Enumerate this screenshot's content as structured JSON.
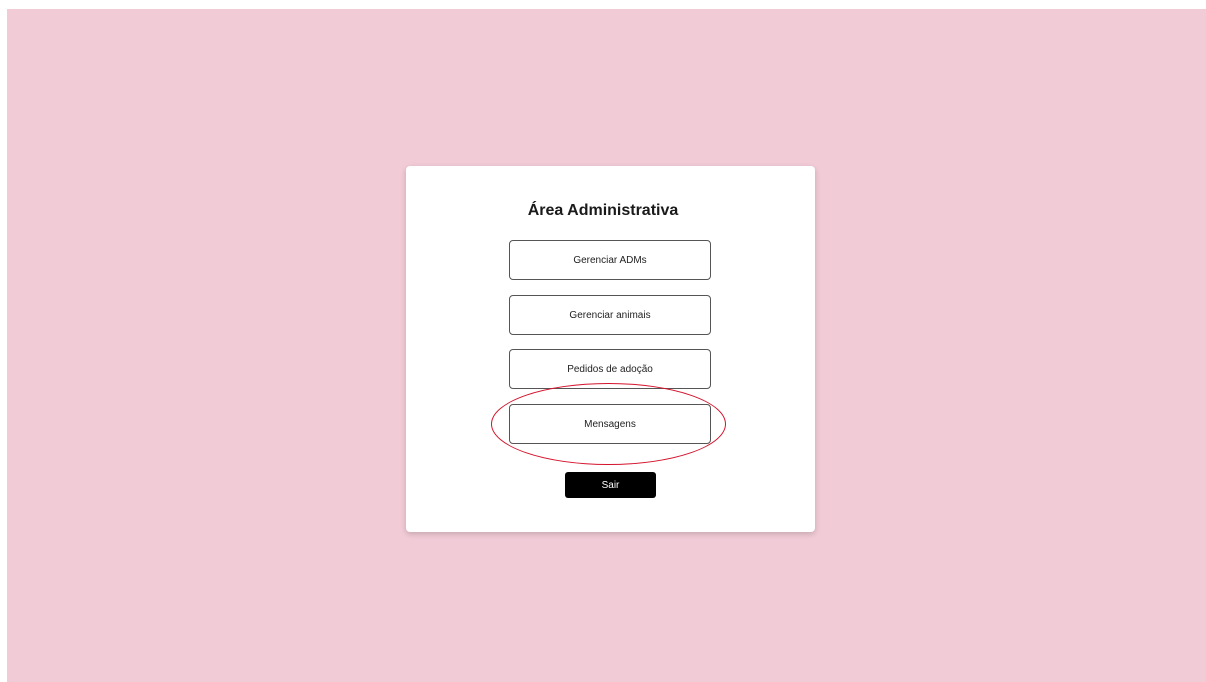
{
  "colors": {
    "page_background": "#f1cbd6",
    "card_background": "#ffffff",
    "logout_background": "#000000",
    "annotation": "#d4132c"
  },
  "admin": {
    "title": "Área Administrativa",
    "buttons": [
      {
        "label": "Gerenciar ADMs"
      },
      {
        "label": "Gerenciar animais"
      },
      {
        "label": "Pedidos de adoção"
      },
      {
        "label": "Mensagens"
      }
    ],
    "logout_label": "Sair"
  }
}
